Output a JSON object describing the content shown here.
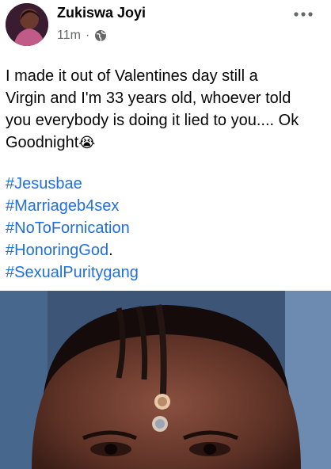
{
  "post": {
    "author": "Zukiswa Joyi",
    "time": "11m",
    "separator": "·",
    "privacy_icon": "globe-icon",
    "more_icon": "more-dots-icon",
    "text_lines": [
      "I made it out of Valentines day still a",
      "Virgin and I'm 33 years old, whoever told",
      "you everybody is doing it lied to you.... Ok",
      "Goodnight"
    ],
    "emoji": "😭",
    "hashtags": [
      "#Jesusbae",
      "#Marriageb4sex",
      "#NoToFornication",
      "#HonoringGod",
      "#SexualPuritygang"
    ],
    "hashtag_suffix_3": "."
  },
  "colors": {
    "link": "#216fdb",
    "meta": "#65676b",
    "text": "#050505"
  }
}
